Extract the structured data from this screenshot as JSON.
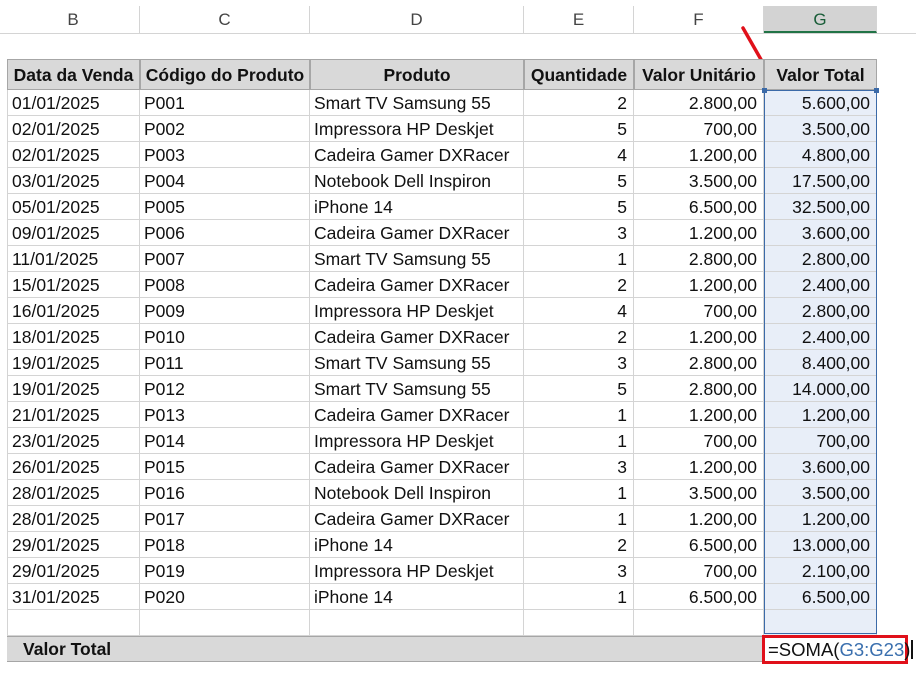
{
  "column_headers": [
    "B",
    "C",
    "D",
    "E",
    "F",
    "G"
  ],
  "selected_column": "G",
  "table": {
    "headers": [
      "Data da Venda",
      "Código do Produto",
      "Produto",
      "Quantidade",
      "Valor Unitário",
      "Valor Total"
    ],
    "rows": [
      [
        "01/01/2025",
        "P001",
        "Smart TV Samsung 55",
        "2",
        "2.800,00",
        "5.600,00"
      ],
      [
        "02/01/2025",
        "P002",
        "Impressora HP Deskjet",
        "5",
        "700,00",
        "3.500,00"
      ],
      [
        "02/01/2025",
        "P003",
        "Cadeira Gamer DXRacer",
        "4",
        "1.200,00",
        "4.800,00"
      ],
      [
        "03/01/2025",
        "P004",
        "Notebook Dell Inspiron",
        "5",
        "3.500,00",
        "17.500,00"
      ],
      [
        "05/01/2025",
        "P005",
        "iPhone 14",
        "5",
        "6.500,00",
        "32.500,00"
      ],
      [
        "09/01/2025",
        "P006",
        "Cadeira Gamer DXRacer",
        "3",
        "1.200,00",
        "3.600,00"
      ],
      [
        "11/01/2025",
        "P007",
        "Smart TV Samsung 55",
        "1",
        "2.800,00",
        "2.800,00"
      ],
      [
        "15/01/2025",
        "P008",
        "Cadeira Gamer DXRacer",
        "2",
        "1.200,00",
        "2.400,00"
      ],
      [
        "16/01/2025",
        "P009",
        "Impressora HP Deskjet",
        "4",
        "700,00",
        "2.800,00"
      ],
      [
        "18/01/2025",
        "P010",
        "Cadeira Gamer DXRacer",
        "2",
        "1.200,00",
        "2.400,00"
      ],
      [
        "19/01/2025",
        "P011",
        "Smart TV Samsung 55",
        "3",
        "2.800,00",
        "8.400,00"
      ],
      [
        "19/01/2025",
        "P012",
        "Smart TV Samsung 55",
        "5",
        "2.800,00",
        "14.000,00"
      ],
      [
        "21/01/2025",
        "P013",
        "Cadeira Gamer DXRacer",
        "1",
        "1.200,00",
        "1.200,00"
      ],
      [
        "23/01/2025",
        "P014",
        "Impressora HP Deskjet",
        "1",
        "700,00",
        "700,00"
      ],
      [
        "26/01/2025",
        "P015",
        "Cadeira Gamer DXRacer",
        "3",
        "1.200,00",
        "3.600,00"
      ],
      [
        "28/01/2025",
        "P016",
        "Notebook Dell Inspiron",
        "1",
        "3.500,00",
        "3.500,00"
      ],
      [
        "28/01/2025",
        "P017",
        "Cadeira Gamer DXRacer",
        "1",
        "1.200,00",
        "1.200,00"
      ],
      [
        "29/01/2025",
        "P018",
        "iPhone 14",
        "2",
        "6.500,00",
        "13.000,00"
      ],
      [
        "29/01/2025",
        "P019",
        "Impressora HP Deskjet",
        "3",
        "700,00",
        "2.100,00"
      ],
      [
        "31/01/2025",
        "P020",
        "iPhone 14",
        "1",
        "6.500,00",
        "6.500,00"
      ],
      [
        "",
        "",
        "",
        "",
        "",
        ""
      ]
    ]
  },
  "total": {
    "label": "Valor Total",
    "formula_prefix": "=SOMA(",
    "formula_ref": "G3:G23",
    "formula_suffix": ")"
  },
  "colors": {
    "header_bg": "#d9d9d9",
    "selection_fill": "#e8eef8",
    "selection_border": "#3b6aa8",
    "highlight_red": "#e0101a",
    "formula_ref_blue": "#3a6fae"
  }
}
